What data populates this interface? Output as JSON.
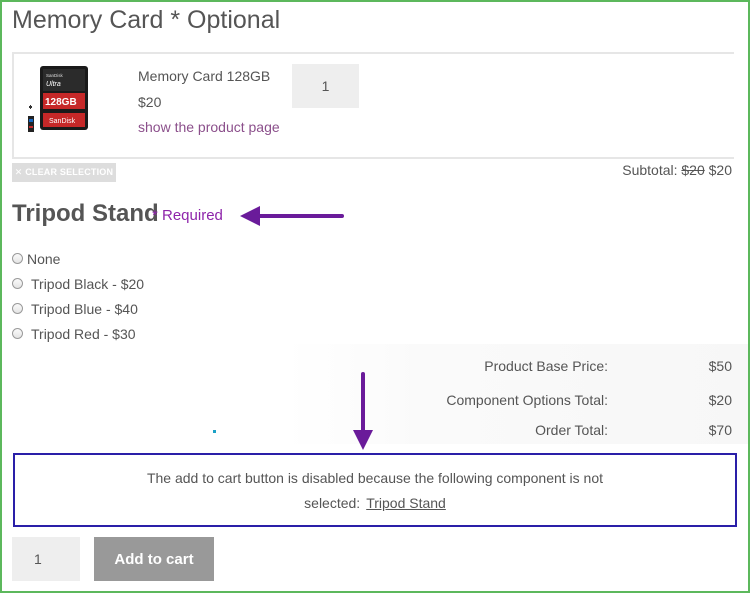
{
  "memory_card": {
    "heading": "Memory Card * Optional",
    "product_name": "Memory Card 128GB",
    "price": "$20",
    "link": "show the product page",
    "quantity": "1",
    "image_brand": "SanDisk",
    "image_model": "Ultra",
    "image_capacity": "128GB",
    "clear_label": "✕ CLEAR SELECTION",
    "subtotal_label": "Subtotal:",
    "subtotal_old": "$20",
    "subtotal_new": "$20"
  },
  "tripod": {
    "heading": "Tripod Stand",
    "required": "* Required",
    "options": [
      {
        "label": "None"
      },
      {
        "label": "Tripod Black - $20"
      },
      {
        "label": "Tripod Blue - $40"
      },
      {
        "label": "Tripod Red - $30"
      }
    ]
  },
  "totals": {
    "base_label": "Product Base Price:",
    "base_value": "$50",
    "options_label": "Component Options Total:",
    "options_value": "$20",
    "order_label": "Order Total:",
    "order_value": "$70"
  },
  "notice": {
    "line1": "The add to cart button is disabled because the following component is not",
    "line2_prefix": "selected:",
    "component_link": "Tripod Stand"
  },
  "cart": {
    "quantity": "1",
    "add_label": "Add to cart"
  },
  "colors": {
    "frame_border": "#5cb85c",
    "annotation_purple": "#6a1b9a",
    "required_purple": "#8e24aa",
    "notice_border": "#2a1fa8",
    "link_purple": "#8b4f8b"
  }
}
